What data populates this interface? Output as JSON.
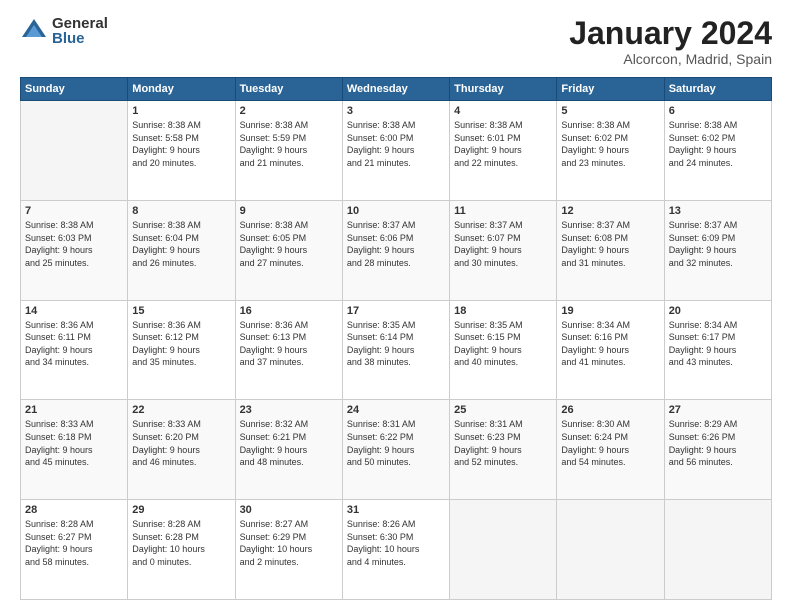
{
  "logo": {
    "general": "General",
    "blue": "Blue"
  },
  "title": "January 2024",
  "subtitle": "Alcorcon, Madrid, Spain",
  "headers": [
    "Sunday",
    "Monday",
    "Tuesday",
    "Wednesday",
    "Thursday",
    "Friday",
    "Saturday"
  ],
  "weeks": [
    [
      {
        "day": "",
        "info": ""
      },
      {
        "day": "1",
        "info": "Sunrise: 8:38 AM\nSunset: 5:58 PM\nDaylight: 9 hours\nand 20 minutes."
      },
      {
        "day": "2",
        "info": "Sunrise: 8:38 AM\nSunset: 5:59 PM\nDaylight: 9 hours\nand 21 minutes."
      },
      {
        "day": "3",
        "info": "Sunrise: 8:38 AM\nSunset: 6:00 PM\nDaylight: 9 hours\nand 21 minutes."
      },
      {
        "day": "4",
        "info": "Sunrise: 8:38 AM\nSunset: 6:01 PM\nDaylight: 9 hours\nand 22 minutes."
      },
      {
        "day": "5",
        "info": "Sunrise: 8:38 AM\nSunset: 6:02 PM\nDaylight: 9 hours\nand 23 minutes."
      },
      {
        "day": "6",
        "info": "Sunrise: 8:38 AM\nSunset: 6:02 PM\nDaylight: 9 hours\nand 24 minutes."
      }
    ],
    [
      {
        "day": "7",
        "info": "Sunrise: 8:38 AM\nSunset: 6:03 PM\nDaylight: 9 hours\nand 25 minutes."
      },
      {
        "day": "8",
        "info": "Sunrise: 8:38 AM\nSunset: 6:04 PM\nDaylight: 9 hours\nand 26 minutes."
      },
      {
        "day": "9",
        "info": "Sunrise: 8:38 AM\nSunset: 6:05 PM\nDaylight: 9 hours\nand 27 minutes."
      },
      {
        "day": "10",
        "info": "Sunrise: 8:37 AM\nSunset: 6:06 PM\nDaylight: 9 hours\nand 28 minutes."
      },
      {
        "day": "11",
        "info": "Sunrise: 8:37 AM\nSunset: 6:07 PM\nDaylight: 9 hours\nand 30 minutes."
      },
      {
        "day": "12",
        "info": "Sunrise: 8:37 AM\nSunset: 6:08 PM\nDaylight: 9 hours\nand 31 minutes."
      },
      {
        "day": "13",
        "info": "Sunrise: 8:37 AM\nSunset: 6:09 PM\nDaylight: 9 hours\nand 32 minutes."
      }
    ],
    [
      {
        "day": "14",
        "info": "Sunrise: 8:36 AM\nSunset: 6:11 PM\nDaylight: 9 hours\nand 34 minutes."
      },
      {
        "day": "15",
        "info": "Sunrise: 8:36 AM\nSunset: 6:12 PM\nDaylight: 9 hours\nand 35 minutes."
      },
      {
        "day": "16",
        "info": "Sunrise: 8:36 AM\nSunset: 6:13 PM\nDaylight: 9 hours\nand 37 minutes."
      },
      {
        "day": "17",
        "info": "Sunrise: 8:35 AM\nSunset: 6:14 PM\nDaylight: 9 hours\nand 38 minutes."
      },
      {
        "day": "18",
        "info": "Sunrise: 8:35 AM\nSunset: 6:15 PM\nDaylight: 9 hours\nand 40 minutes."
      },
      {
        "day": "19",
        "info": "Sunrise: 8:34 AM\nSunset: 6:16 PM\nDaylight: 9 hours\nand 41 minutes."
      },
      {
        "day": "20",
        "info": "Sunrise: 8:34 AM\nSunset: 6:17 PM\nDaylight: 9 hours\nand 43 minutes."
      }
    ],
    [
      {
        "day": "21",
        "info": "Sunrise: 8:33 AM\nSunset: 6:18 PM\nDaylight: 9 hours\nand 45 minutes."
      },
      {
        "day": "22",
        "info": "Sunrise: 8:33 AM\nSunset: 6:20 PM\nDaylight: 9 hours\nand 46 minutes."
      },
      {
        "day": "23",
        "info": "Sunrise: 8:32 AM\nSunset: 6:21 PM\nDaylight: 9 hours\nand 48 minutes."
      },
      {
        "day": "24",
        "info": "Sunrise: 8:31 AM\nSunset: 6:22 PM\nDaylight: 9 hours\nand 50 minutes."
      },
      {
        "day": "25",
        "info": "Sunrise: 8:31 AM\nSunset: 6:23 PM\nDaylight: 9 hours\nand 52 minutes."
      },
      {
        "day": "26",
        "info": "Sunrise: 8:30 AM\nSunset: 6:24 PM\nDaylight: 9 hours\nand 54 minutes."
      },
      {
        "day": "27",
        "info": "Sunrise: 8:29 AM\nSunset: 6:26 PM\nDaylight: 9 hours\nand 56 minutes."
      }
    ],
    [
      {
        "day": "28",
        "info": "Sunrise: 8:28 AM\nSunset: 6:27 PM\nDaylight: 9 hours\nand 58 minutes."
      },
      {
        "day": "29",
        "info": "Sunrise: 8:28 AM\nSunset: 6:28 PM\nDaylight: 10 hours\nand 0 minutes."
      },
      {
        "day": "30",
        "info": "Sunrise: 8:27 AM\nSunset: 6:29 PM\nDaylight: 10 hours\nand 2 minutes."
      },
      {
        "day": "31",
        "info": "Sunrise: 8:26 AM\nSunset: 6:30 PM\nDaylight: 10 hours\nand 4 minutes."
      },
      {
        "day": "",
        "info": ""
      },
      {
        "day": "",
        "info": ""
      },
      {
        "day": "",
        "info": ""
      }
    ]
  ]
}
